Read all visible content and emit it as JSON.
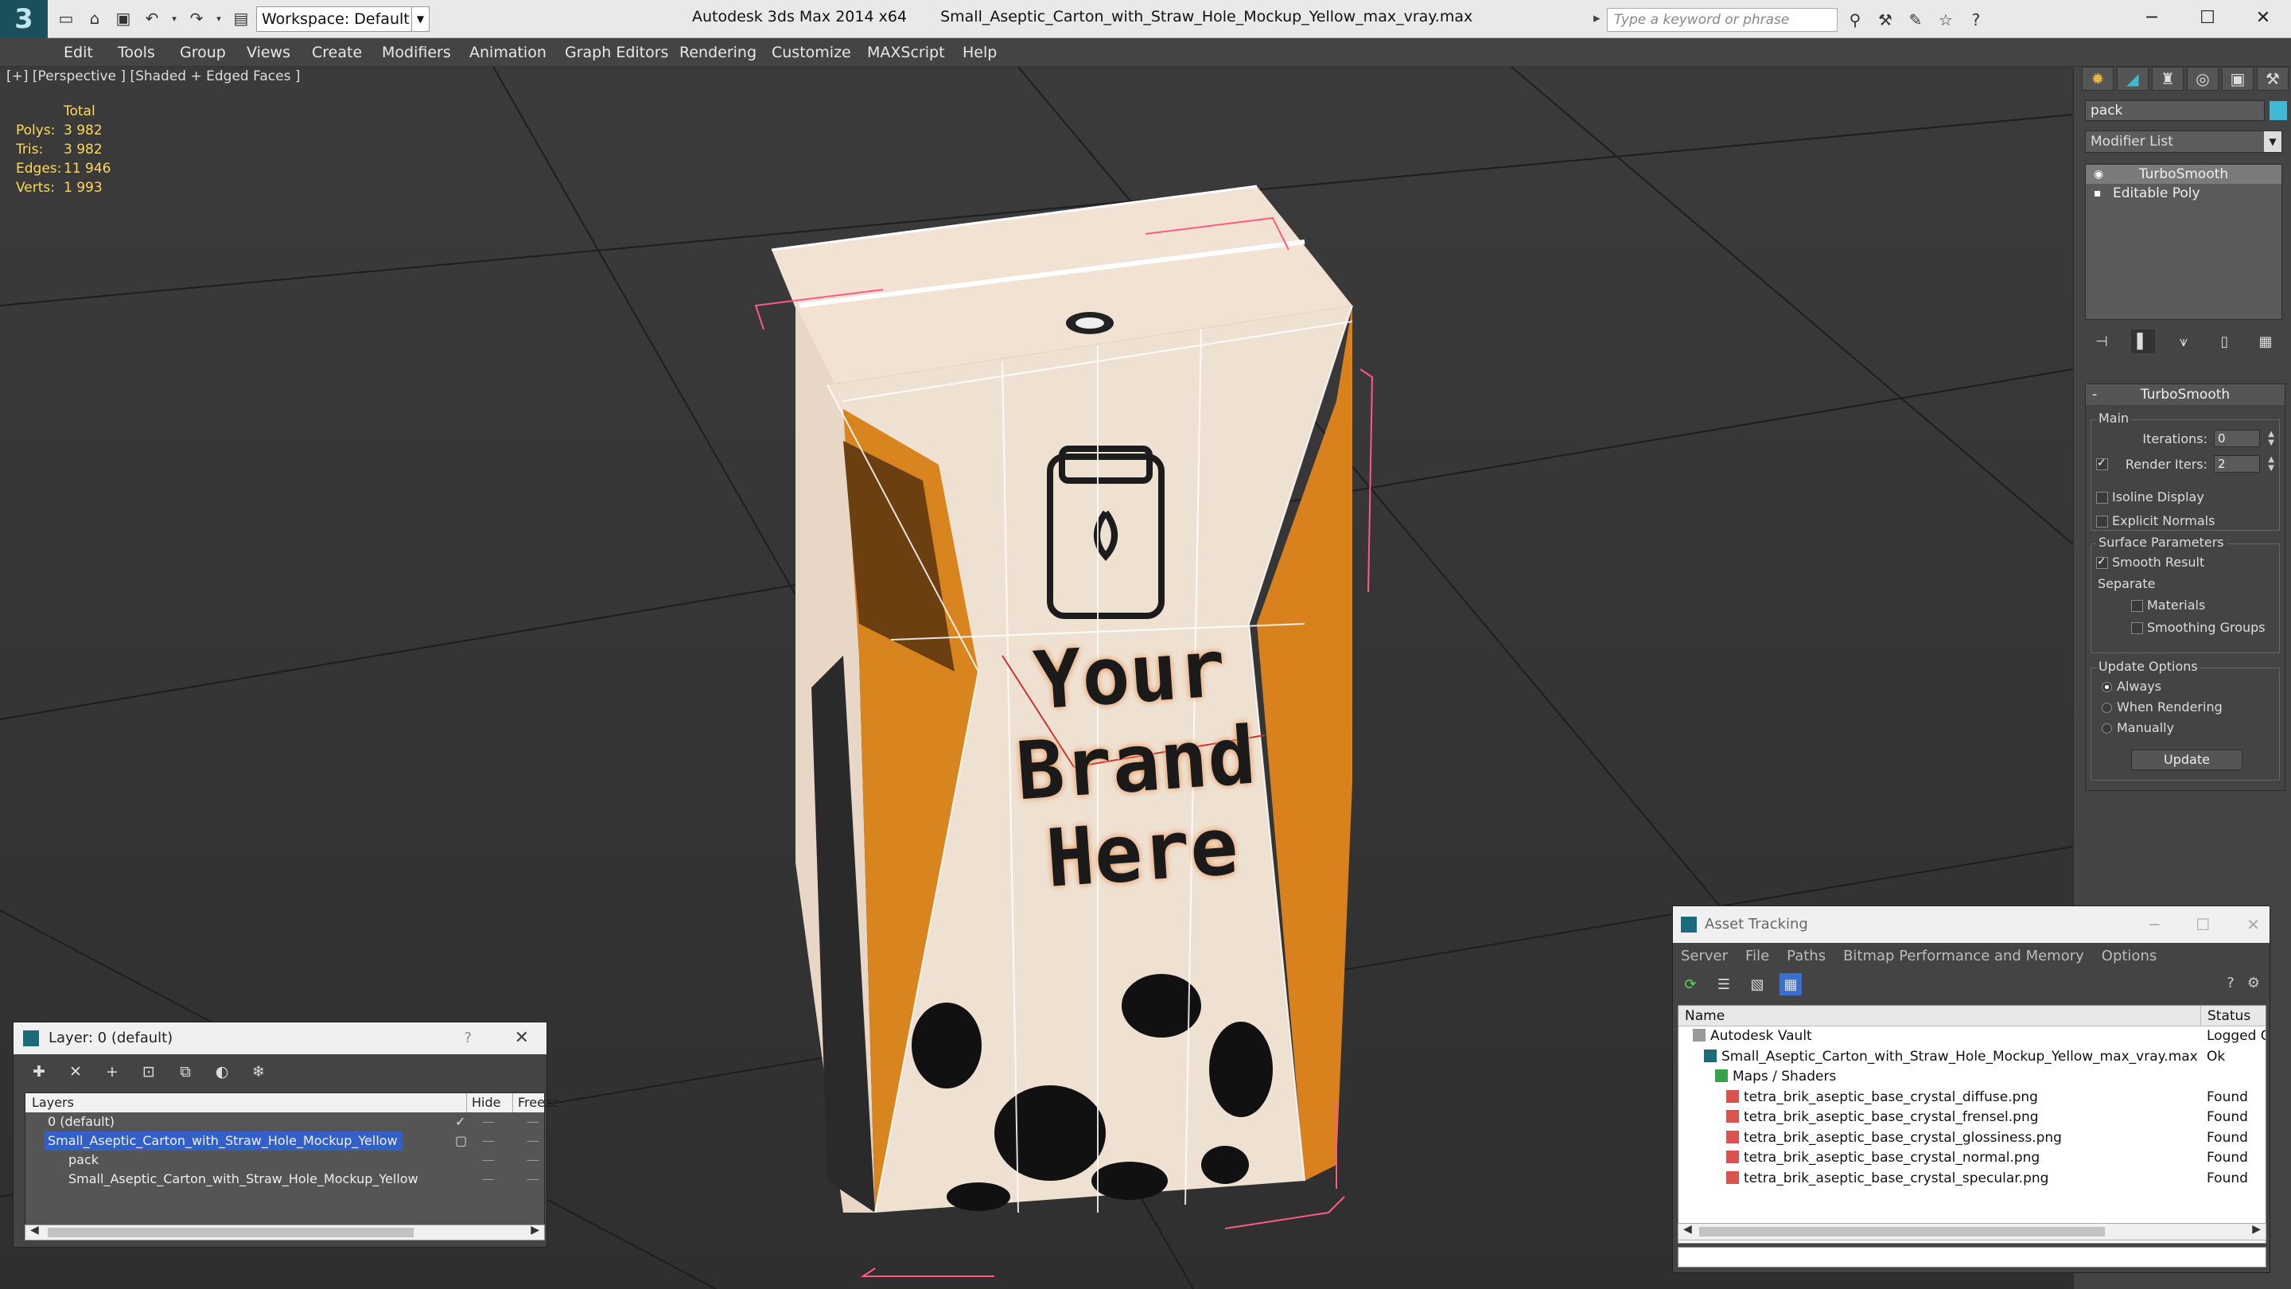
{
  "titlebar": {
    "workspace": "Workspace: Default",
    "app_name": "Autodesk 3ds Max  2014 x64",
    "file_name": "Small_Aseptic_Carton_with_Straw_Hole_Mockup_Yellow_max_vray.max",
    "search_placeholder": "Type a keyword or phrase"
  },
  "menu": [
    "Edit",
    "Tools",
    "Group",
    "Views",
    "Create",
    "Modifiers",
    "Animation",
    "Graph Editors",
    "Rendering",
    "Customize",
    "MAXScript",
    "Help"
  ],
  "viewport": {
    "label": "[+] [Perspective ] [Shaded + Edged Faces ]",
    "stats": {
      "header": "Total",
      "rows": [
        {
          "k": "Polys:",
          "v": "3 982"
        },
        {
          "k": "Tris:",
          "v": "3 982"
        },
        {
          "k": "Edges:",
          "v": "11 946"
        },
        {
          "k": "Verts:",
          "v": "1 993"
        }
      ]
    },
    "brand_text": [
      "Your",
      "Brand",
      "Here"
    ]
  },
  "command_panel": {
    "object_name": "pack",
    "object_color": "#3fb9d4",
    "modifier_list": "Modifier List",
    "stack": [
      "TurboSmooth",
      "Editable Poly"
    ],
    "rollout_title": "TurboSmooth",
    "main_group": "Main",
    "iterations_label": "Iterations:",
    "iterations_value": "0",
    "render_iters_label": "Render Iters:",
    "render_iters_value": "2",
    "isoline": "Isoline Display",
    "explicit_normals": "Explicit Normals",
    "surface_group": "Surface Parameters",
    "smooth_result": "Smooth Result",
    "separate": "Separate",
    "materials": "Materials",
    "smoothing_groups": "Smoothing Groups",
    "update_group": "Update Options",
    "always": "Always",
    "when_rendering": "When Rendering",
    "manually": "Manually",
    "update_button": "Update"
  },
  "layer_dialog": {
    "title": "Layer: 0 (default)",
    "help": "?",
    "columns": {
      "layers": "Layers",
      "hide": "Hide",
      "freeze": "Freeze"
    },
    "rows": [
      {
        "name": "0 (default)",
        "indent": 0,
        "selected": false
      },
      {
        "name": "Small_Aseptic_Carton_with_Straw_Hole_Mockup_Yellow",
        "indent": 0,
        "selected": true
      },
      {
        "name": "pack",
        "indent": 1,
        "selected": false
      },
      {
        "name": "Small_Aseptic_Carton_with_Straw_Hole_Mockup_Yellow",
        "indent": 1,
        "selected": false
      }
    ]
  },
  "asset_dialog": {
    "title": "Asset Tracking",
    "menu": [
      "Server",
      "File",
      "Paths",
      "Bitmap Performance and Memory",
      "Options"
    ],
    "columns": {
      "name": "Name",
      "status": "Status"
    },
    "rows": [
      {
        "name": "Autodesk Vault",
        "status": "Logged C",
        "indent": 0,
        "icon": "vault"
      },
      {
        "name": "Small_Aseptic_Carton_with_Straw_Hole_Mockup_Yellow_max_vray.max",
        "status": "Ok",
        "indent": 1,
        "icon": "max"
      },
      {
        "name": "Maps / Shaders",
        "status": "",
        "indent": 2,
        "icon": "maps"
      },
      {
        "name": "tetra_brik_aseptic_base_crystal_diffuse.png",
        "status": "Found",
        "indent": 3,
        "icon": "png"
      },
      {
        "name": "tetra_brik_aseptic_base_crystal_frensel.png",
        "status": "Found",
        "indent": 3,
        "icon": "png"
      },
      {
        "name": "tetra_brik_aseptic_base_crystal_glossiness.png",
        "status": "Found",
        "indent": 3,
        "icon": "png"
      },
      {
        "name": "tetra_brik_aseptic_base_crystal_normal.png",
        "status": "Found",
        "indent": 3,
        "icon": "png"
      },
      {
        "name": "tetra_brik_aseptic_base_crystal_specular.png",
        "status": "Found",
        "indent": 3,
        "icon": "png"
      }
    ]
  }
}
